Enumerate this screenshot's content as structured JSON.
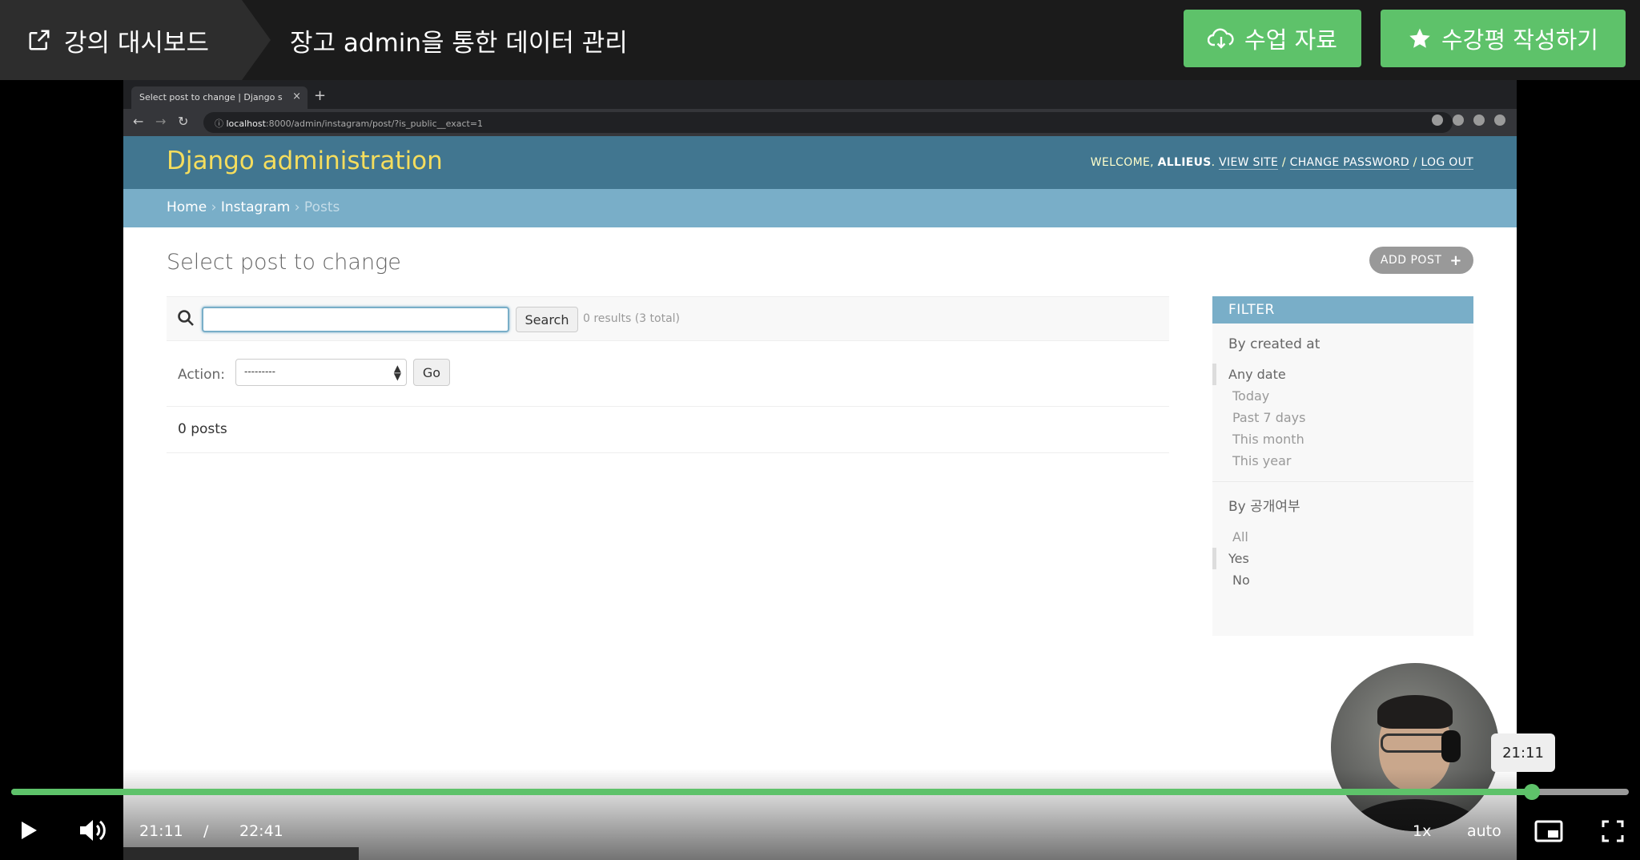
{
  "header": {
    "dashboard_label": "강의 대시보드",
    "lecture_title": "장고 admin을 통한 데이터 관리",
    "materials_label": "수업 자료",
    "review_label": "수강평 작성하기",
    "accent_color": "#5ec26a"
  },
  "browser": {
    "tab_title": "Select post to change | Django s",
    "url_host": "localhost",
    "url_rest": ":8000/admin/instagram/post/?is_public__exact=1"
  },
  "admin": {
    "brand": "Django administration",
    "welcome": "WELCOME,",
    "username": "ALLIEUS",
    "view_site": "VIEW SITE",
    "change_password": "CHANGE PASSWORD",
    "log_out": "LOG OUT",
    "breadcrumb_home": "Home",
    "breadcrumb_app": "Instagram",
    "breadcrumb_current": "Posts",
    "page_title": "Select post to change",
    "add_button": "ADD POST",
    "search_button": "Search",
    "search_value": "",
    "results_text": "0 results (3 total)",
    "action_label": "Action:",
    "action_selected": "---------",
    "go_button": "Go",
    "count_text": "0 posts",
    "filter": {
      "title": "FILTER",
      "groups": [
        {
          "heading": "By created at",
          "options": [
            "Any date",
            "Today",
            "Past 7 days",
            "This month",
            "This year"
          ],
          "selected": "Any date"
        },
        {
          "heading": "By 공개여부",
          "options": [
            "All",
            "Yes",
            "No"
          ],
          "selected": "Yes"
        }
      ]
    }
  },
  "player": {
    "current_time": "21:11",
    "separator": "/",
    "duration": "22:41",
    "tooltip_time": "21:11",
    "progress": 0.94,
    "speed": "1x",
    "quality": "auto"
  }
}
